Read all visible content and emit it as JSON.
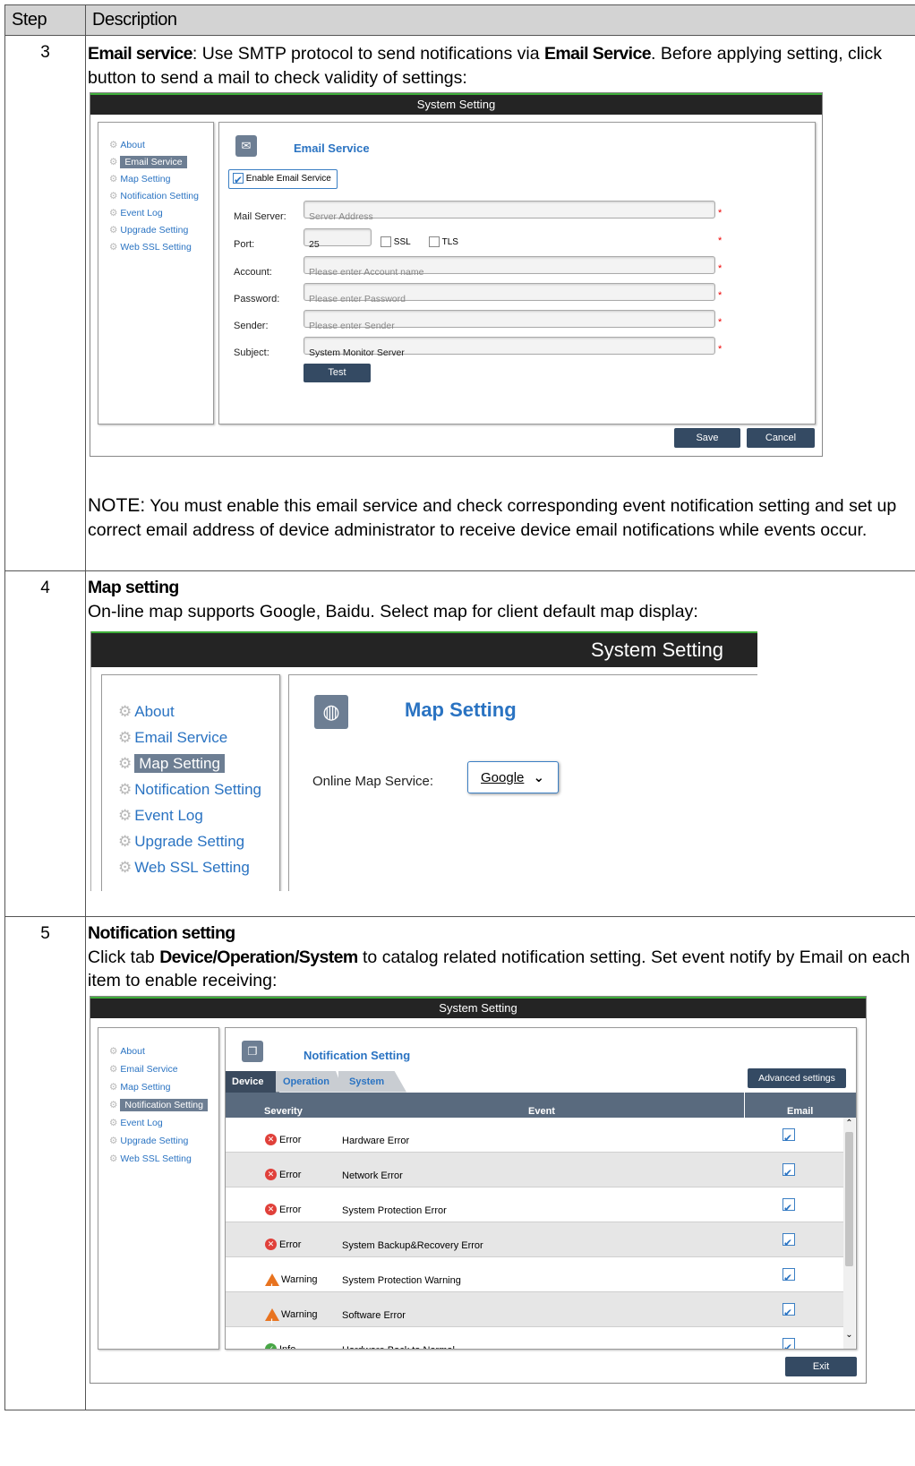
{
  "table": {
    "header_step": "Step",
    "header_description": "Description"
  },
  "step3": {
    "number": "3",
    "title_bold": "Email service",
    "intro_a": ": Use SMTP protocol to send notifications via ",
    "intro_bold": "Email Service",
    "intro_b": ". Before applying setting, click button to send a mail to check validity of settings:",
    "note_label": "NOTE:",
    "note_text": " You must enable this email service and check corresponding event notification setting and set up correct email address of device administrator to receive device email notifications while events occur.",
    "screenshot": {
      "window_title": "System Setting",
      "nav": [
        "About",
        "Email Service",
        "Map Setting",
        "Notification Setting",
        "Event Log",
        "Upgrade Setting",
        "Web SSL Setting"
      ],
      "selected_nav": "Email Service",
      "panel_title": "Email Service",
      "enable_label": "Enable Email Service",
      "enable_checked": true,
      "fields": {
        "mail_server_label": "Mail Server:",
        "mail_server_placeholder": "Server Address",
        "port_label": "Port:",
        "port_value": "25",
        "ssl_label": "SSL",
        "tls_label": "TLS",
        "account_label": "Account:",
        "account_placeholder": "Please enter Account name",
        "password_label": "Password:",
        "password_placeholder": "Please enter Password",
        "sender_label": "Sender:",
        "sender_placeholder": "Please enter Sender",
        "subject_label": "Subject:",
        "subject_value": "System Monitor Server"
      },
      "required_mark": "*",
      "test_button": "Test",
      "save_button": "Save",
      "cancel_button": "Cancel"
    }
  },
  "step4": {
    "number": "4",
    "title": "Map setting",
    "intro": "On-line map supports Google, Baidu. Select map for client default map display:",
    "screenshot": {
      "window_title": "System Setting",
      "nav": [
        "About",
        "Email Service",
        "Map Setting",
        "Notification Setting",
        "Event Log",
        "Upgrade Setting",
        "Web SSL Setting"
      ],
      "selected_nav": "Map Setting",
      "panel_title": "Map Setting",
      "online_map_label": "Online Map Service:",
      "online_map_value": "Google"
    }
  },
  "step5": {
    "number": "5",
    "title": "Notification setting",
    "intro_a": "Click tab ",
    "intro_bold": "Device/Operation/System",
    "intro_b": " to catalog related notification setting. Set event notify by Email on each item to enable receiving:",
    "screenshot": {
      "window_title": "System Setting",
      "nav": [
        "About",
        "Email Service",
        "Map Setting",
        "Notification Setting",
        "Event Log",
        "Upgrade Setting",
        "Web SSL Setting"
      ],
      "selected_nav": "Notification Setting",
      "panel_title": "Notification Setting",
      "tabs": [
        "Device",
        "Operation",
        "System"
      ],
      "active_tab": "Device",
      "advanced_button": "Advanced settings",
      "columns": [
        "Severity",
        "Event",
        "Email"
      ],
      "rows": [
        {
          "severity": "Error",
          "event": "Hardware Error",
          "email": true
        },
        {
          "severity": "Error",
          "event": "Network Error",
          "email": true
        },
        {
          "severity": "Error",
          "event": "System Protection Error",
          "email": true
        },
        {
          "severity": "Error",
          "event": "System Backup&Recovery Error",
          "email": true
        },
        {
          "severity": "Warning",
          "event": "System Protection Warning",
          "email": true
        },
        {
          "severity": "Warning",
          "event": "Software Error",
          "email": true
        },
        {
          "severity": "Info",
          "event": "Hardware Back to Normal",
          "email": true
        }
      ],
      "exit_button": "Exit"
    }
  },
  "colors": {
    "link_blue": "#2a73c2",
    "selected_gray": "#6d7e93",
    "dark_button": "#344a63",
    "error_red": "#e0403a",
    "warning_orange": "#e8731f",
    "info_green": "#48a646"
  }
}
